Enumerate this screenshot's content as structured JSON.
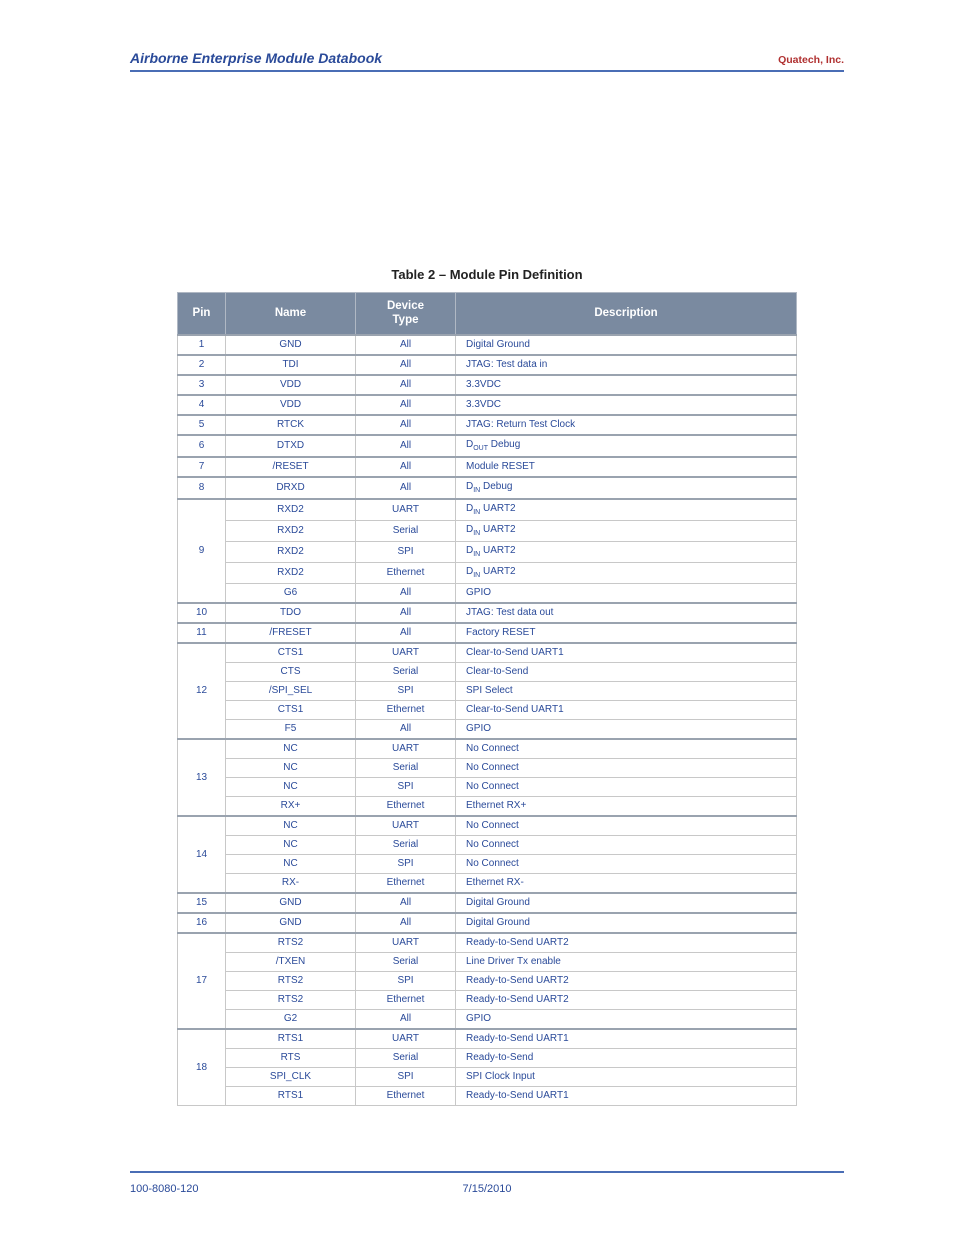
{
  "header": {
    "left": "Airborne Enterprise Module Databook",
    "right": "Quatech, Inc."
  },
  "caption": "Table 2 – Module Pin Definition",
  "columns": [
    "Pin",
    "Name",
    "Device Type",
    "Description"
  ],
  "rows": [
    {
      "pin": "1",
      "sub": [
        {
          "name": "GND",
          "type": "All",
          "desc": "Digital Ground"
        }
      ]
    },
    {
      "pin": "2",
      "sub": [
        {
          "name": "TDI",
          "type": "All",
          "desc": "JTAG: Test data in"
        }
      ]
    },
    {
      "pin": "3",
      "sub": [
        {
          "name": "VDD",
          "type": "All",
          "desc": "3.3VDC"
        }
      ]
    },
    {
      "pin": "4",
      "sub": [
        {
          "name": "VDD",
          "type": "All",
          "desc": "3.3VDC"
        }
      ]
    },
    {
      "pin": "5",
      "sub": [
        {
          "name": "RTCK",
          "type": "All",
          "desc": "JTAG: Return Test Clock"
        }
      ]
    },
    {
      "pin": "6",
      "sub": [
        {
          "name": "DTXD",
          "type": "All",
          "desc_html": "D<sub>OUT</sub> Debug"
        }
      ]
    },
    {
      "pin": "7",
      "sub": [
        {
          "name": "/RESET",
          "type": "All",
          "desc": "Module RESET"
        }
      ]
    },
    {
      "pin": "8",
      "sub": [
        {
          "name": "DRXD",
          "type": "All",
          "desc_html": "D<sub>IN</sub> Debug"
        }
      ]
    },
    {
      "pin": "9",
      "sub": [
        {
          "name": "RXD2",
          "type": "UART",
          "desc_html": "D<sub>IN</sub> UART2"
        },
        {
          "name": "RXD2",
          "type": "Serial",
          "desc_html": "D<sub>IN</sub> UART2"
        },
        {
          "name": "RXD2",
          "type": "SPI",
          "desc_html": "D<sub>IN</sub> UART2"
        },
        {
          "name": "RXD2",
          "type": "Ethernet",
          "desc_html": "D<sub>IN</sub> UART2"
        },
        {
          "name": "G6",
          "type": "All",
          "desc": "GPIO"
        }
      ]
    },
    {
      "pin": "10",
      "sub": [
        {
          "name": "TDO",
          "type": "All",
          "desc": "JTAG: Test data out"
        }
      ]
    },
    {
      "pin": "11",
      "sub": [
        {
          "name": "/FRESET",
          "type": "All",
          "desc": "Factory RESET"
        }
      ]
    },
    {
      "pin": "12",
      "sub": [
        {
          "name": "CTS1",
          "type": "UART",
          "desc": "Clear-to-Send UART1"
        },
        {
          "name": "CTS",
          "type": "Serial",
          "desc": "Clear-to-Send"
        },
        {
          "name": "/SPI_SEL",
          "type": "SPI",
          "desc": "SPI Select"
        },
        {
          "name": "CTS1",
          "type": "Ethernet",
          "desc": "Clear-to-Send UART1"
        },
        {
          "name": "F5",
          "type": "All",
          "desc": "GPIO"
        }
      ]
    },
    {
      "pin": "13",
      "sub": [
        {
          "name": "NC",
          "type": "UART",
          "desc": "No Connect"
        },
        {
          "name": "NC",
          "type": "Serial",
          "desc": "No Connect"
        },
        {
          "name": "NC",
          "type": "SPI",
          "desc": "No Connect"
        },
        {
          "name": "RX+",
          "type": "Ethernet",
          "desc": "Ethernet RX+"
        }
      ]
    },
    {
      "pin": "14",
      "sub": [
        {
          "name": "NC",
          "type": "UART",
          "desc": "No Connect"
        },
        {
          "name": "NC",
          "type": "Serial",
          "desc": "No Connect"
        },
        {
          "name": "NC",
          "type": "SPI",
          "desc": "No Connect"
        },
        {
          "name": "RX-",
          "type": "Ethernet",
          "desc": "Ethernet RX-"
        }
      ]
    },
    {
      "pin": "15",
      "sub": [
        {
          "name": "GND",
          "type": "All",
          "desc": "Digital Ground"
        }
      ]
    },
    {
      "pin": "16",
      "sub": [
        {
          "name": "GND",
          "type": "All",
          "desc": "Digital Ground"
        }
      ]
    },
    {
      "pin": "17",
      "sub": [
        {
          "name": "RTS2",
          "type": "UART",
          "desc": "Ready-to-Send UART2"
        },
        {
          "name": "/TXEN",
          "type": "Serial",
          "desc": "Line Driver Tx enable"
        },
        {
          "name": "RTS2",
          "type": "SPI",
          "desc": "Ready-to-Send UART2"
        },
        {
          "name": "RTS2",
          "type": "Ethernet",
          "desc": "Ready-to-Send UART2"
        },
        {
          "name": "G2",
          "type": "All",
          "desc": "GPIO"
        }
      ]
    },
    {
      "pin": "18",
      "sub": [
        {
          "name": "RTS1",
          "type": "UART",
          "desc": "Ready-to-Send UART1"
        },
        {
          "name": "RTS",
          "type": "Serial",
          "desc": "Ready-to-Send"
        },
        {
          "name": "SPI_CLK",
          "type": "SPI",
          "desc": "SPI Clock Input"
        },
        {
          "name": "RTS1",
          "type": "Ethernet",
          "desc": "Ready-to-Send UART1"
        }
      ]
    }
  ],
  "footer": {
    "left": "100-8080-120",
    "center": "7/15/2010",
    "right": ""
  }
}
